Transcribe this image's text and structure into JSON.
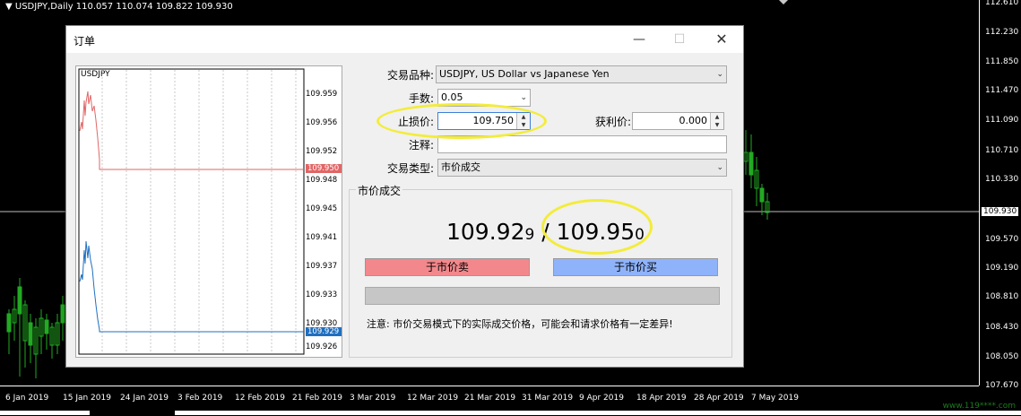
{
  "terminal": {
    "title_strip": "USDJPY,Daily  110.057 110.074 109.822 109.930",
    "price_labels": [
      "112.610",
      "112.230",
      "111.850",
      "111.470",
      "111.090",
      "110.710",
      "110.330",
      "109.930",
      "109.570",
      "109.190",
      "108.810",
      "108.430",
      "108.050",
      "107.670"
    ],
    "current_price": "109.930",
    "date_labels": [
      "6 Jan 2019",
      "15 Jan 2019",
      "24 Jan 2019",
      "3 Feb 2019",
      "12 Feb 2019",
      "21 Feb 2019",
      "3 Mar 2019",
      "12 Mar 2019",
      "21 Mar 2019",
      "31 Mar 2019",
      "9 Apr 2019",
      "18 Apr 2019",
      "28 Apr 2019",
      "7 May 2019"
    ]
  },
  "dialog": {
    "title": "订单",
    "minimize_icon": "minimize-icon",
    "maximize_icon": "maximize-icon",
    "close_icon": "close-icon",
    "mini_chart": {
      "symbol": "USDJPY",
      "price_labels": [
        "109.959",
        "109.956",
        "109.952",
        "109.948",
        "109.945",
        "109.941",
        "109.937",
        "109.933",
        "109.930",
        "109.926"
      ],
      "ask_tag": "109.950",
      "bid_tag": "109.929",
      "ask_color": "#e06666",
      "bid_color": "#1f6fc0"
    },
    "form": {
      "symbol_label": "交易品种:",
      "symbol_value": "USDJPY, US Dollar vs Japanese Yen",
      "volume_label": "手数:",
      "volume_value": "0.05",
      "sl_label": "止损价:",
      "sl_value": "109.750",
      "tp_label": "获利价:",
      "tp_value": "0.000",
      "comment_label": "注释:",
      "comment_value": "",
      "type_label": "交易类型:",
      "type_value": "市价成交"
    },
    "market": {
      "group_title": "市价成交",
      "bid_main": "109.92",
      "bid_last": "9",
      "separator": " / ",
      "ask_main": "109.95",
      "ask_last": "0",
      "sell_label": "于市价卖",
      "buy_label": "于市价买",
      "sell_color": "#f3888c",
      "buy_color": "#8fb3fb",
      "note": "注意: 市价交易模式下的实际成交价格，可能会和请求价格有一定差异!"
    }
  },
  "watermark": "www.119****.com"
}
